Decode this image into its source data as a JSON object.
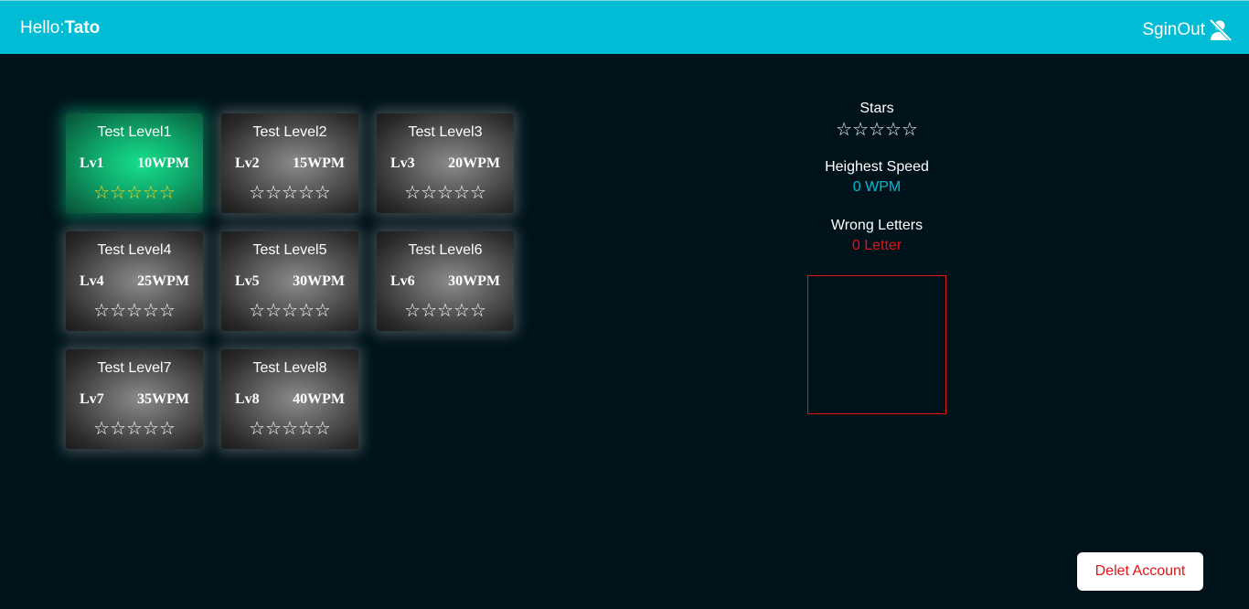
{
  "header": {
    "greeting_prefix": "Hello:",
    "user_name": "Tato",
    "signout_label": "SginOut",
    "signout_icon": "user-slash-icon"
  },
  "levels": [
    {
      "title": "Test Level1",
      "lv": "Lv1",
      "wpm": "10WPM",
      "stars": "☆☆☆☆☆",
      "active": true
    },
    {
      "title": "Test Level2",
      "lv": "Lv2",
      "wpm": "15WPM",
      "stars": "☆☆☆☆☆",
      "active": false
    },
    {
      "title": "Test Level3",
      "lv": "Lv3",
      "wpm": "20WPM",
      "stars": "☆☆☆☆☆",
      "active": false
    },
    {
      "title": "Test Level4",
      "lv": "Lv4",
      "wpm": "25WPM",
      "stars": "☆☆☆☆☆",
      "active": false
    },
    {
      "title": "Test Level5",
      "lv": "Lv5",
      "wpm": "30WPM",
      "stars": "☆☆☆☆☆",
      "active": false
    },
    {
      "title": "Test Level6",
      "lv": "Lv6",
      "wpm": "30WPM",
      "stars": "☆☆☆☆☆",
      "active": false
    },
    {
      "title": "Test Level7",
      "lv": "Lv7",
      "wpm": "35WPM",
      "stars": "☆☆☆☆☆",
      "active": false
    },
    {
      "title": "Test Level8",
      "lv": "Lv8",
      "wpm": "40WPM",
      "stars": "☆☆☆☆☆",
      "active": false
    }
  ],
  "stats": {
    "stars_label": "Stars",
    "stars_value": "☆☆☆☆☆",
    "speed_label": "Heighest Speed",
    "speed_value": "0 WPM",
    "wrong_label": "Wrong Letters",
    "wrong_value": "0 Letter"
  },
  "footer": {
    "delete_label": "Delet Account"
  },
  "colors": {
    "header": "#00bcd4",
    "background": "#00131b",
    "active_card": "#17e08c",
    "accent_blue": "#00bcd4",
    "accent_red": "#e01414",
    "active_star": "#ffd21f"
  }
}
